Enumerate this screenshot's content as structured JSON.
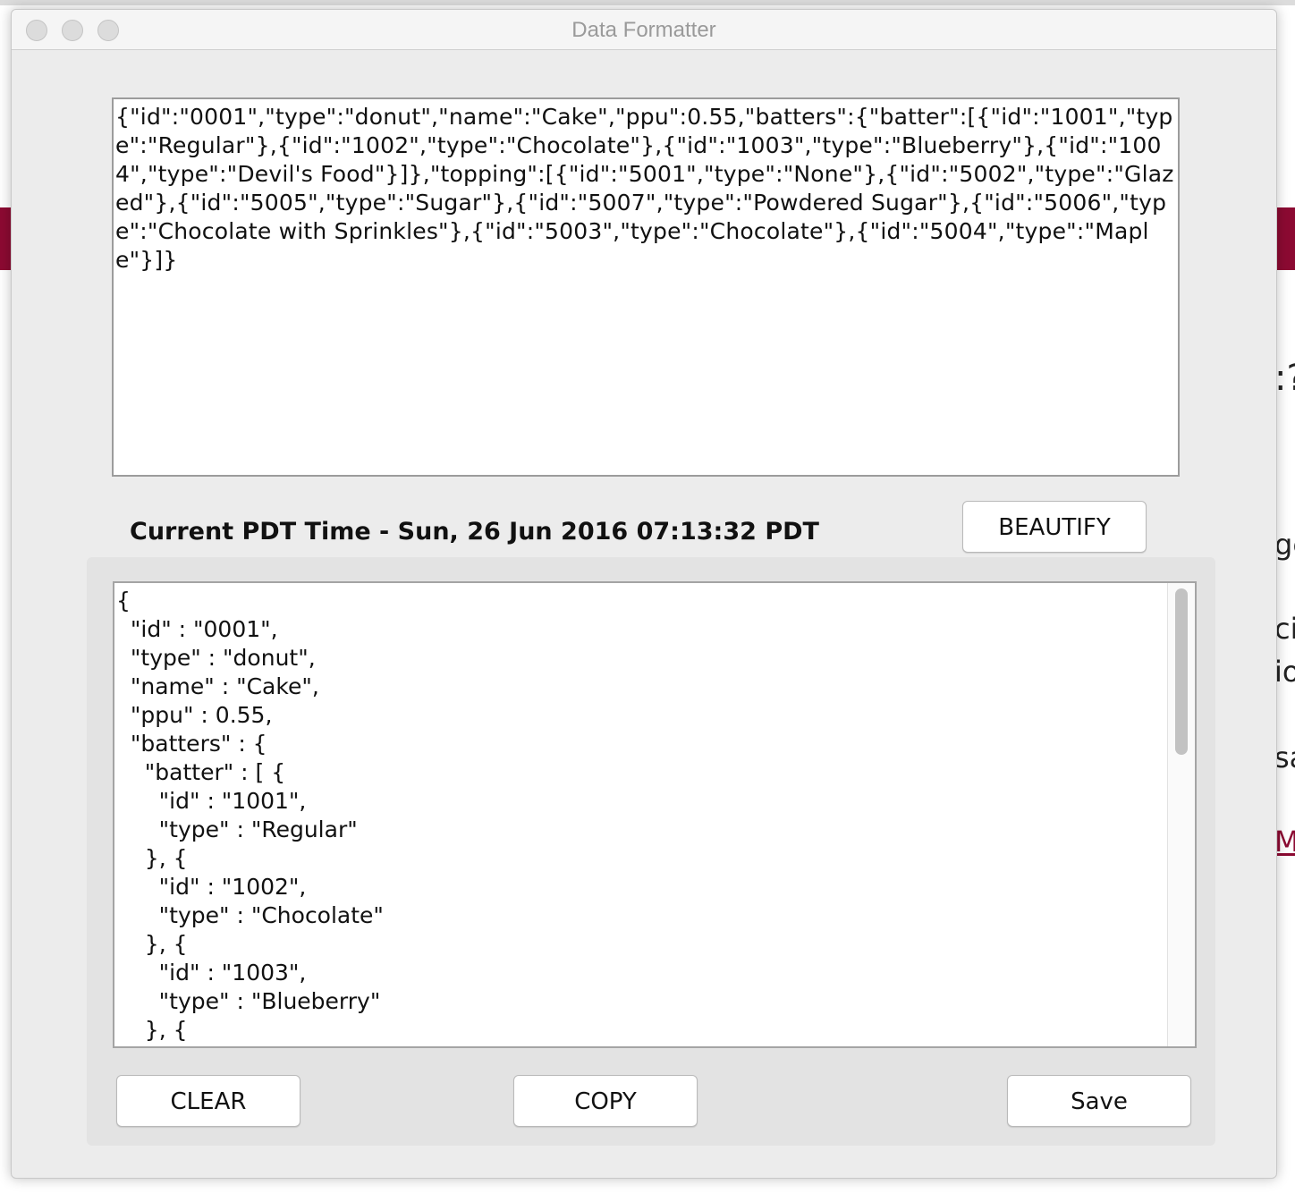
{
  "window": {
    "title": "Data Formatter"
  },
  "input": {
    "text": "{\"id\":\"0001\",\"type\":\"donut\",\"name\":\"Cake\",\"ppu\":0.55,\"batters\":{\"batter\":[{\"id\":\"1001\",\"type\":\"Regular\"},{\"id\":\"1002\",\"type\":\"Chocolate\"},{\"id\":\"1003\",\"type\":\"Blueberry\"},{\"id\":\"1004\",\"type\":\"Devil's Food\"}]},\"topping\":[{\"id\":\"5001\",\"type\":\"None\"},{\"id\":\"5002\",\"type\":\"Glazed\"},{\"id\":\"5005\",\"type\":\"Sugar\"},{\"id\":\"5007\",\"type\":\"Powdered Sugar\"},{\"id\":\"5006\",\"type\":\"Chocolate with Sprinkles\"},{\"id\":\"5003\",\"type\":\"Chocolate\"},{\"id\":\"5004\",\"type\":\"Maple\"}]}"
  },
  "time_label": "Current PDT Time - Sun, 26 Jun 2016 07:13:32 PDT",
  "buttons": {
    "beautify": "BEAUTIFY",
    "clear": "CLEAR",
    "copy": "COPY",
    "save": "Save"
  },
  "output": {
    "text": "{\n  \"id\" : \"0001\",\n  \"type\" : \"donut\",\n  \"name\" : \"Cake\",\n  \"ppu\" : 0.55,\n  \"batters\" : {\n    \"batter\" : [ {\n      \"id\" : \"1001\",\n      \"type\" : \"Regular\"\n    }, {\n      \"id\" : \"1002\",\n      \"type\" : \"Chocolate\"\n    }, {\n      \"id\" : \"1003\",\n      \"type\" : \"Blueberry\"\n    }, {"
  },
  "background_page": {
    "fragments": [
      ":?",
      "ge",
      "cif",
      "io",
      "sa",
      "M"
    ]
  },
  "colors": {
    "accent_band": "#8c0a32",
    "window_bg": "#ececec",
    "title_text": "#9a9a9a"
  }
}
